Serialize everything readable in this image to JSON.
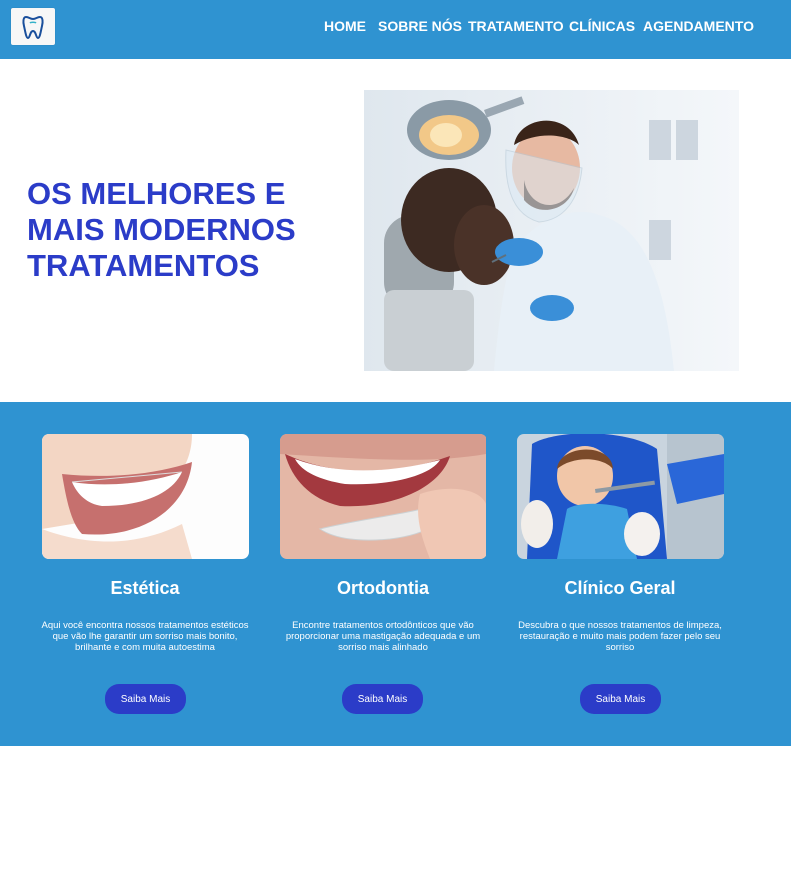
{
  "nav": {
    "items": [
      {
        "label": "HOME"
      },
      {
        "label": "SOBRE NÓS"
      },
      {
        "label": "TRATAMENTO"
      },
      {
        "label": "CLÍNICAS"
      },
      {
        "label": "AGENDAMENTO"
      }
    ]
  },
  "hero": {
    "title": "OS MELHORES E\nMAIS MODERNOS\nTRATAMENTOS"
  },
  "services": [
    {
      "title": "Estética",
      "description": "Aqui você encontra nossos tratamentos estéticos que vão lhe garantir um sorriso mais bonito, brilhante e com muita autoestima",
      "button": "Saiba Mais"
    },
    {
      "title": "Ortodontia",
      "description": "Encontre tratamentos ortodônticos que vão proporcionar uma mastigação adequada e um sorriso mais alinhado",
      "button": "Saiba Mais"
    },
    {
      "title": "Clínico Geral",
      "description": "Descubra o que nossos tratamentos de limpeza, restauração e muito mais podem fazer pelo seu sorriso",
      "button": "Saiba Mais"
    }
  ],
  "colors": {
    "primary_blue": "#2f93d1",
    "accent_indigo": "#2b3cc8",
    "text_light": "#ffffff"
  }
}
